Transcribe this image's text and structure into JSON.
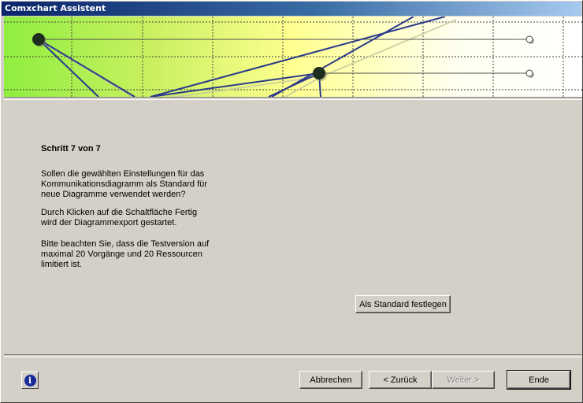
{
  "window": {
    "title": "Comxchart Assistent"
  },
  "step": {
    "title": "Schritt 7 von 7",
    "paragraph1": [
      "Sollen die gewählten Einstellungen für das",
      "Kommunikationsdiagramm als Standard für",
      "neue Diagramme verwendet werden?"
    ],
    "paragraph2": [
      "Durch Klicken auf die Schaltfläche Fertig",
      "wird der Diagrammexport gestartet."
    ],
    "paragraph3": [
      "Bitte beachten Sie, dass die Testversion auf",
      "maximal 20 Vorgänge und 20 Ressourcen",
      "limitiert ist."
    ]
  },
  "buttons": {
    "set_default": "Als Standard festlegen",
    "cancel": "Abbrechen",
    "back": "< Zurück",
    "next": "Weiter >",
    "finish": "Ende"
  },
  "icons": {
    "info": "info-icon",
    "info_glyph": "i"
  }
}
